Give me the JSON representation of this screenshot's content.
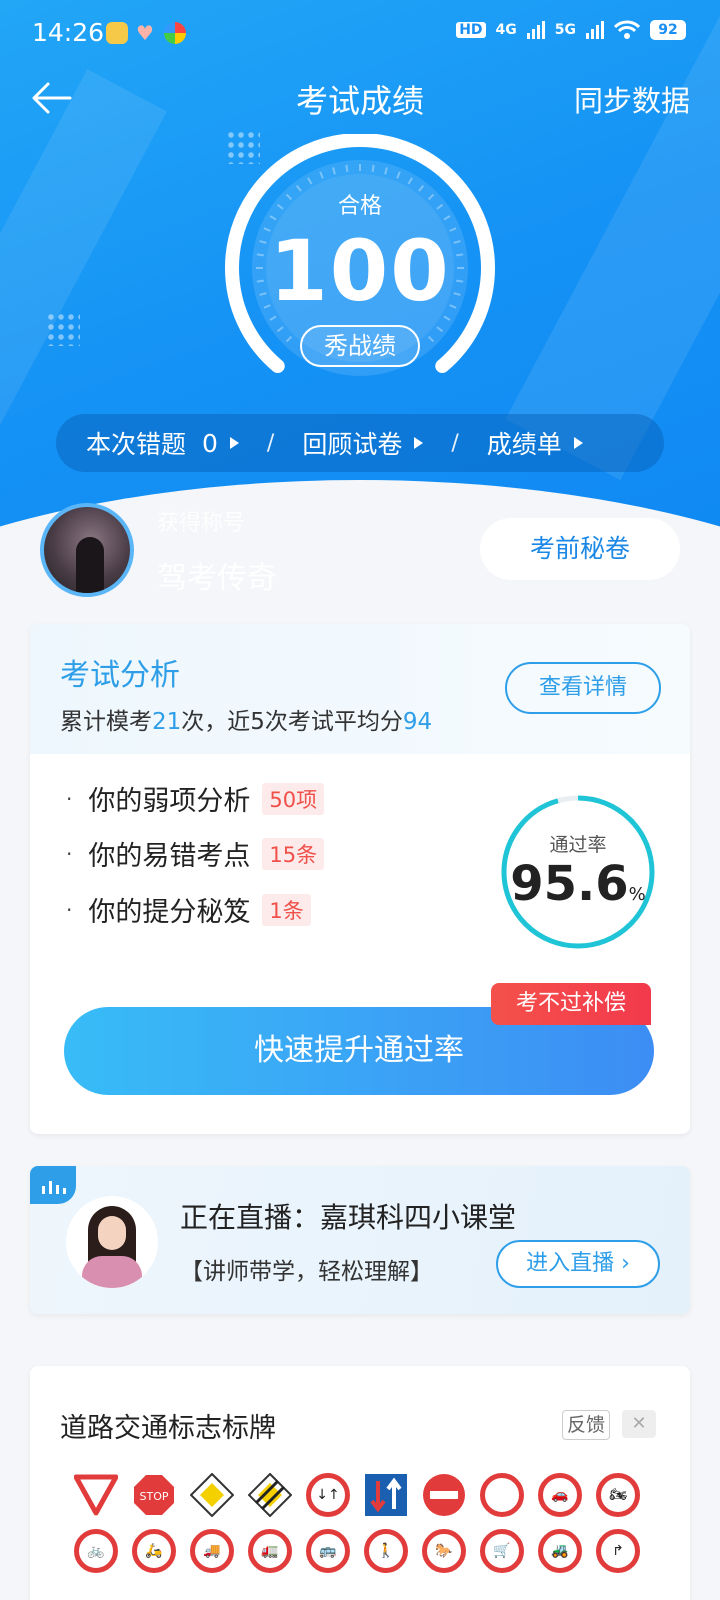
{
  "status_bar": {
    "time": "14:26",
    "battery": "92",
    "net1": "4G",
    "net2": "5G",
    "hd": "HD"
  },
  "nav": {
    "title": "考试成绩",
    "sync": "同步数据"
  },
  "score": {
    "pass_label": "合格",
    "value": "100",
    "show_button": "秀战绩"
  },
  "links": [
    {
      "label": "本次错题",
      "count": "0"
    },
    {
      "label": "回顾试卷"
    },
    {
      "label": "成绩单"
    }
  ],
  "links_separator": "/",
  "profile": {
    "title_label": "获得称号",
    "title_value": "驾考传奇",
    "secret_button": "考前秘卷"
  },
  "analysis": {
    "title": "考试分析",
    "summary_prefix": "累计模考",
    "mock_count": "21",
    "summary_mid": "次，近5次考试平均分",
    "avg_score": "94",
    "detail_button": "查看详情",
    "items": [
      {
        "label": "你的弱项分析",
        "badge": "50项"
      },
      {
        "label": "你的易错考点",
        "badge": "15条"
      },
      {
        "label": "你的提分秘笈",
        "badge": "1条"
      }
    ],
    "pass_rate_label": "通过率",
    "pass_rate": "95.6",
    "pass_rate_unit": "%",
    "pass_rate_fraction": 0.956,
    "boost_button": "快速提升通过率",
    "compensation_tag": "考不过补偿"
  },
  "live": {
    "title": "正在直播：嘉琪科四小课堂",
    "subtitle": "【讲师带学，轻松理解】",
    "enter_button": "进入直播"
  },
  "signs_card": {
    "title": "道路交通标志标牌",
    "feedback": "反馈",
    "close": "✕",
    "stop_text": "STOP"
  },
  "colors": {
    "brand_blue": "#1592f5",
    "accent": "#2e9ee8",
    "alert_red": "#f0504a",
    "ring_teal": "#1fc4d6"
  }
}
